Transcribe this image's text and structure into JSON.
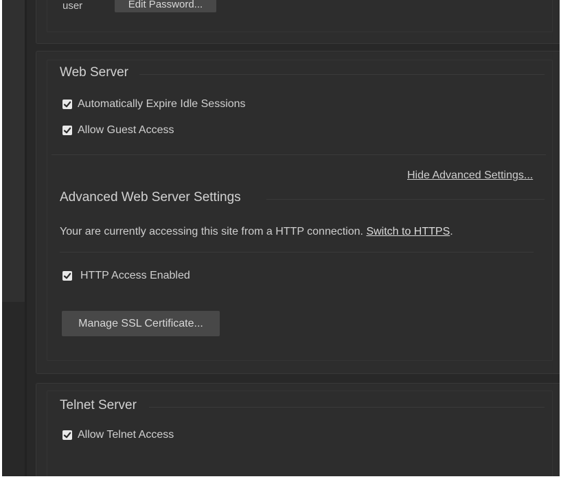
{
  "user_section": {
    "user_label": "user",
    "edit_password_button": "Edit Password..."
  },
  "web_server": {
    "title": "Web Server",
    "options": [
      {
        "label": "Automatically Expire Idle Sessions",
        "checked": true
      },
      {
        "label": "Allow Guest Access",
        "checked": true
      }
    ],
    "toggle_advanced_link": "Hide Advanced Settings..."
  },
  "advanced": {
    "title": "Advanced Web Server Settings",
    "connection_text": "Your are currently accessing this site from a HTTP connection.",
    "switch_link": "Switch to HTTPS",
    "period": ".",
    "http_access": {
      "label": "HTTP Access Enabled",
      "checked": true
    },
    "manage_ssl_button": "Manage SSL Certificate..."
  },
  "telnet_server": {
    "title": "Telnet Server",
    "options": [
      {
        "label": "Allow Telnet Access",
        "checked": true
      }
    ]
  }
}
